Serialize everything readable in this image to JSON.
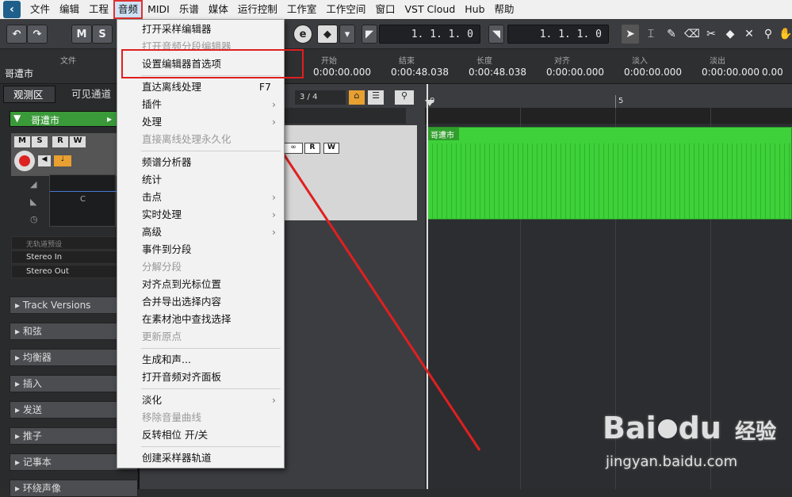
{
  "menubar": {
    "items": [
      "文件",
      "编辑",
      "工程",
      "音频",
      "MIDI",
      "乐谱",
      "媒体",
      "运行控制",
      "工作室",
      "工作空间",
      "窗口",
      "VST Cloud",
      "Hub",
      "帮助"
    ],
    "active_index": 3
  },
  "toolbar": {
    "m_label": "M",
    "s_label": "S",
    "e_label": "e",
    "left_locator": "1. 1. 1.   0",
    "right_locator": "1. 1. 1.   0"
  },
  "infoline": {
    "file_label": "文件",
    "file_value": "哥遭市",
    "columns": [
      {
        "label": "开始",
        "value": "0:00:00.000"
      },
      {
        "label": "结束",
        "value": "0:00:48.038"
      },
      {
        "label": "长度",
        "value": "0:00:48.038"
      },
      {
        "label": "对齐",
        "value": "0:00:00.000"
      },
      {
        "label": "淡入",
        "value": "0:00:00.000"
      },
      {
        "label": "淡出",
        "value": "0:00:00.000"
      },
      {
        "label": "",
        "value": "0.00"
      }
    ]
  },
  "inspector": {
    "tabs": [
      "观测区",
      "可见通道"
    ],
    "track_name": "哥遭市",
    "pan_letter": "C",
    "no_preset": "无轨道预设",
    "input": "Stereo In",
    "output": "Stereo Out",
    "sections": [
      "Track Versions",
      "和弦",
      "均衡器",
      "插入",
      "发送",
      "推子",
      "记事本",
      "环绕声像"
    ]
  },
  "project": {
    "page": "3 / 4",
    "ruler_marks": [
      "0",
      "5"
    ],
    "clip_name": "哥遭市"
  },
  "dropdown": {
    "items": [
      {
        "label": "打开采样编辑器",
        "disabled": false
      },
      {
        "label": "打开音频分段编辑器",
        "disabled": true
      },
      {
        "label": "设置编辑器首选项",
        "disabled": false
      },
      {
        "sep": true
      },
      {
        "label": "直达离线处理",
        "shortcut": "F7",
        "disabled": false
      },
      {
        "label": "插件",
        "submenu": true,
        "disabled": false
      },
      {
        "label": "处理",
        "submenu": true,
        "disabled": false
      },
      {
        "label": "直接离线处理永久化",
        "disabled": true
      },
      {
        "sep": true
      },
      {
        "label": "频谱分析器",
        "disabled": false
      },
      {
        "label": "统计",
        "disabled": false
      },
      {
        "label": "击点",
        "submenu": true,
        "disabled": false
      },
      {
        "label": "实时处理",
        "submenu": true,
        "disabled": false
      },
      {
        "label": "高级",
        "submenu": true,
        "disabled": false
      },
      {
        "label": "事件到分段",
        "disabled": false
      },
      {
        "label": "分解分段",
        "disabled": true
      },
      {
        "label": "对齐点到光标位置",
        "disabled": false
      },
      {
        "label": "合并导出选择内容",
        "disabled": false
      },
      {
        "label": "在素材池中查找选择",
        "disabled": false
      },
      {
        "label": "更新原点",
        "disabled": true
      },
      {
        "sep": true
      },
      {
        "label": "生成和声...",
        "disabled": false
      },
      {
        "label": "打开音频对齐面板",
        "disabled": false
      },
      {
        "sep": true
      },
      {
        "label": "淡化",
        "submenu": true,
        "disabled": false
      },
      {
        "label": "移除音量曲线",
        "disabled": true
      },
      {
        "label": "反转相位 开/关",
        "disabled": false
      },
      {
        "sep": true
      },
      {
        "label": "创建采样器轨道",
        "disabled": false
      }
    ]
  },
  "watermark": {
    "brand": "Bai",
    "brand2": "du",
    "cn": "经验",
    "url": "jingyan.baidu.com"
  },
  "colors": {
    "clip_green": "#3fd13a",
    "highlight_red": "#e02020",
    "menu_bg": "#f2f2f2"
  }
}
